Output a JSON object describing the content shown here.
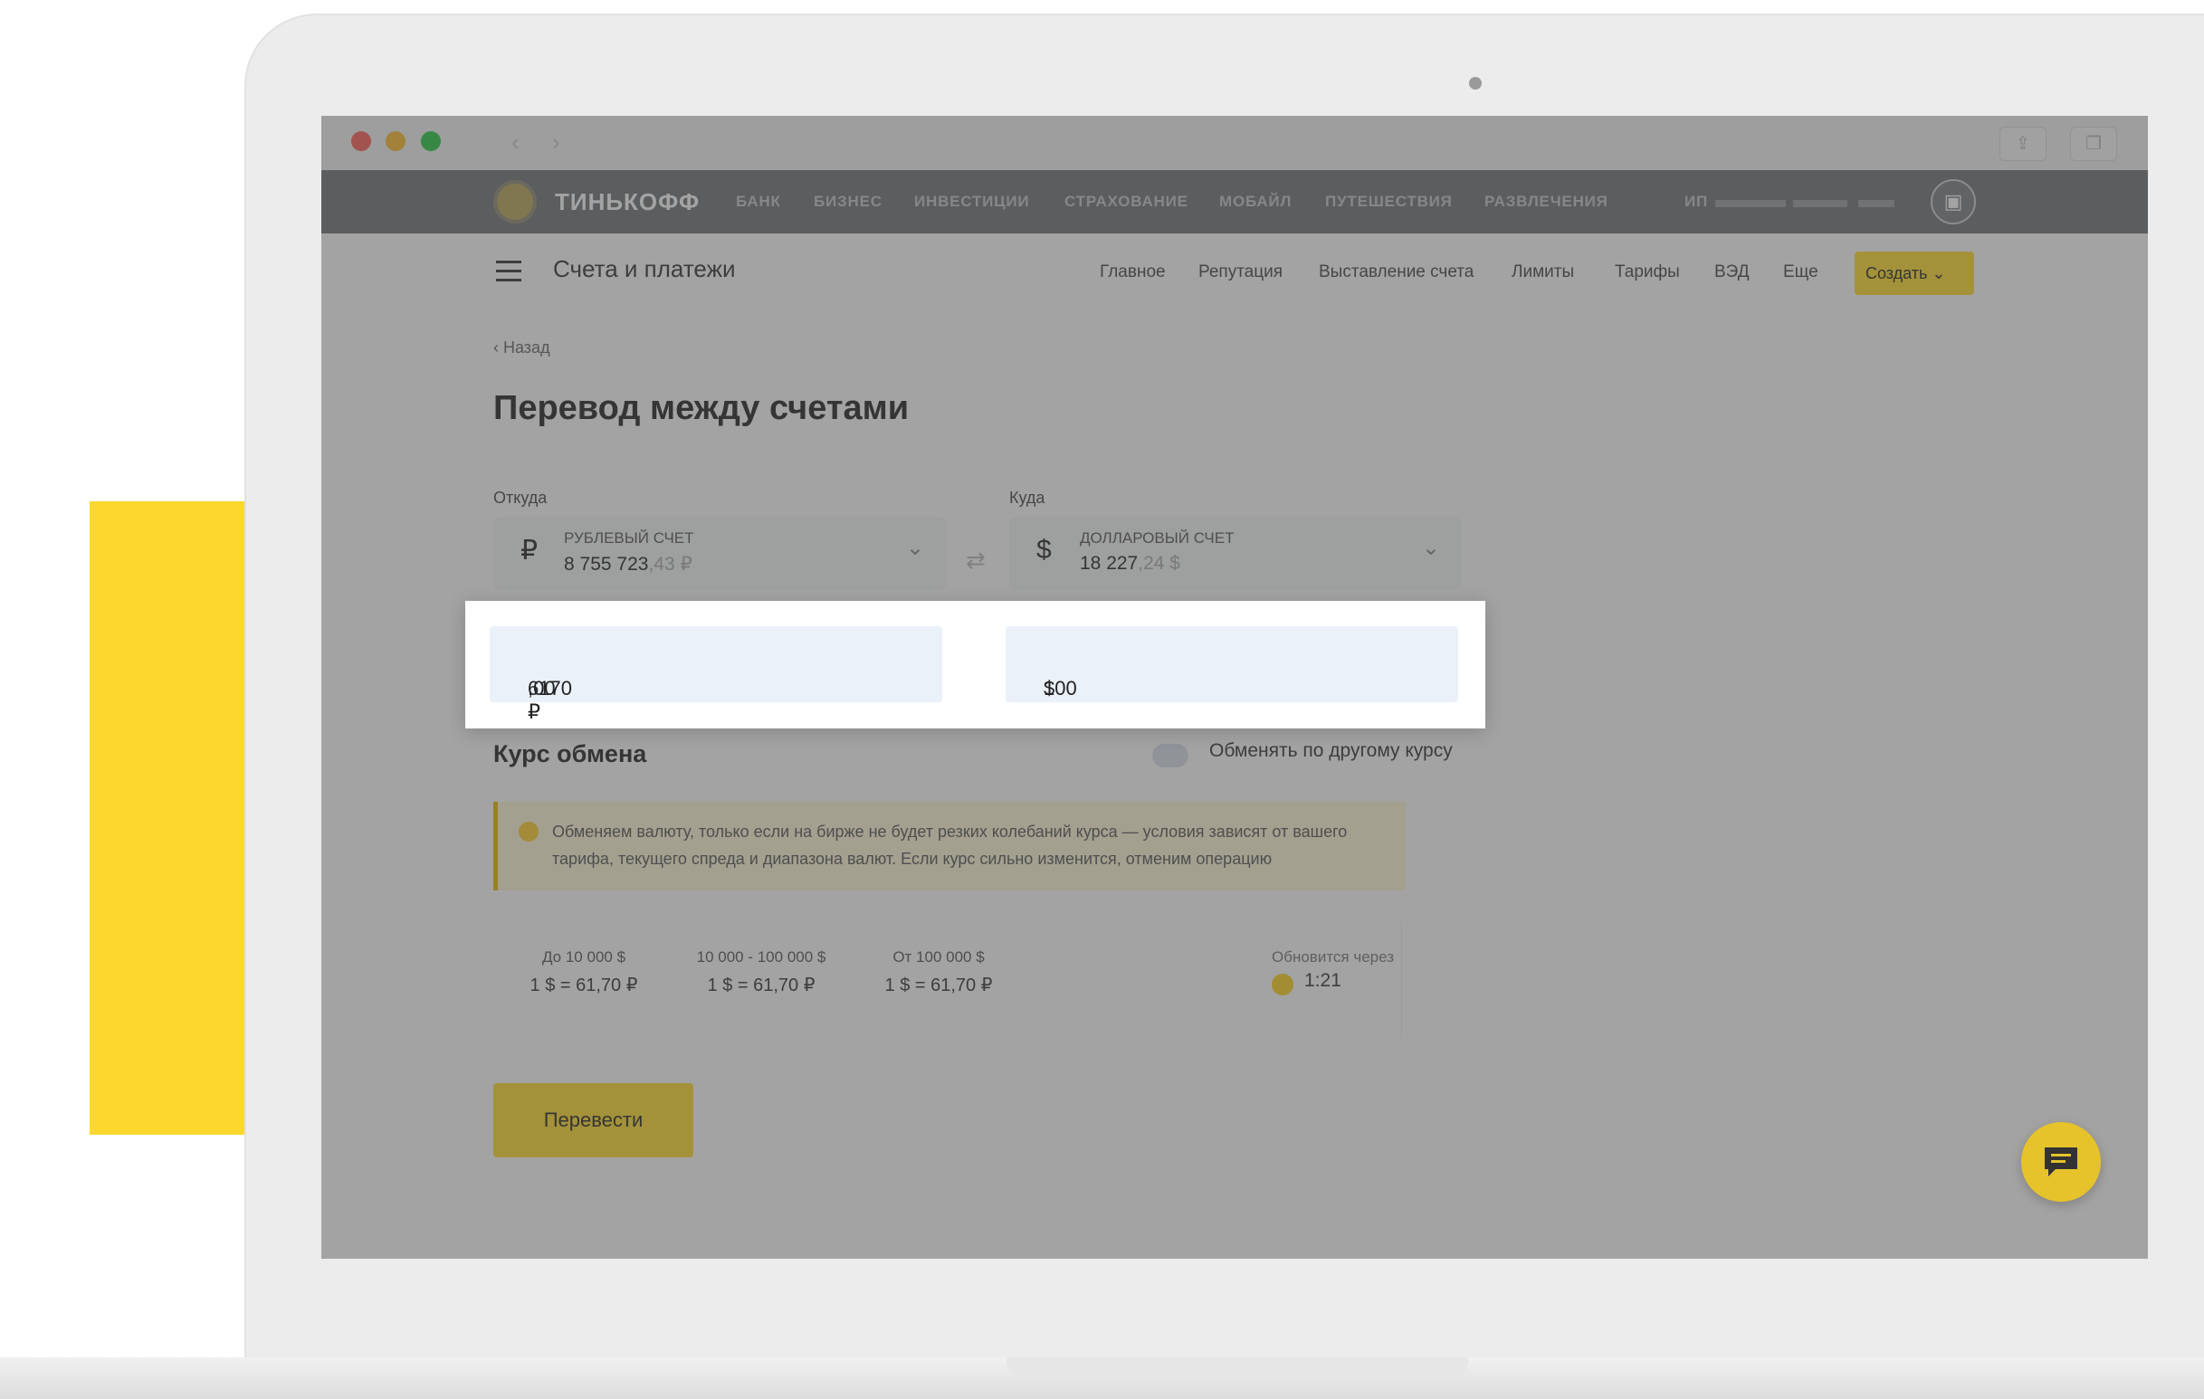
{
  "browser": {
    "back_label": "‹",
    "forward_label": "›",
    "share_icon": "share-icon",
    "tabs_icon": "tabs-icon"
  },
  "topnav": {
    "brand": "ТИНЬКОФФ",
    "items": [
      "БАНК",
      "БИЗНЕС",
      "ИНВЕСТИЦИИ",
      "СТРАХОВАНИЕ",
      "МОБАЙЛ",
      "ПУТЕШЕСТВИЯ",
      "РАЗВЛЕЧЕНИЯ"
    ],
    "account_prefix": "ИП"
  },
  "subheader": {
    "section_title": "Счета и платежи",
    "items": [
      "Главное",
      "Репутация",
      "Выставление счета",
      "Лимиты",
      "Тарифы",
      "ВЭД",
      "Еще"
    ],
    "create_label": "Создать"
  },
  "page": {
    "back_label": "Назад",
    "title": "Перевод между счетами",
    "from_label": "Откуда",
    "to_label": "Куда"
  },
  "from_account": {
    "currency_symbol": "₽",
    "name": "РУБЛЕВЫЙ СЧЕТ",
    "balance_main": "8 755 723",
    "balance_rest": ",43 ₽"
  },
  "to_account": {
    "currency_symbol": "$",
    "name": "ДОЛЛАРОВЫЙ СЧЕТ",
    "balance_main": "18 227",
    "balance_rest": ",24 $"
  },
  "amount_from": {
    "main": "6170",
    "rest": ",00 ₽"
  },
  "amount_to": {
    "main": "100",
    "rest": " $"
  },
  "rate": {
    "title": "Курс обмена",
    "alt_label": "Обменять по другому курсу",
    "notice": "Обменяем валюту, только если на бирже не будет резких колебаний курса — условия зависят от вашего тарифа, текущего спреда и диапазона валют. Если курс сильно изменится, отменим операцию",
    "tiers": [
      {
        "range": "До 10 000 $",
        "rate": "1 $ = 61,70 ₽"
      },
      {
        "range": "10 000 - 100 000 $",
        "rate": "1 $ = 61,70 ₽"
      },
      {
        "range": "От 100 000 $",
        "rate": "1 $ = 61,70 ₽"
      }
    ],
    "updates_label": "Обновится через",
    "timer": "1:21"
  },
  "transfer_label": "Перевести",
  "colors": {
    "accent": "#ffdd2d",
    "brand_bar": "#6f7276",
    "page_yellow": "#fcd82f"
  }
}
